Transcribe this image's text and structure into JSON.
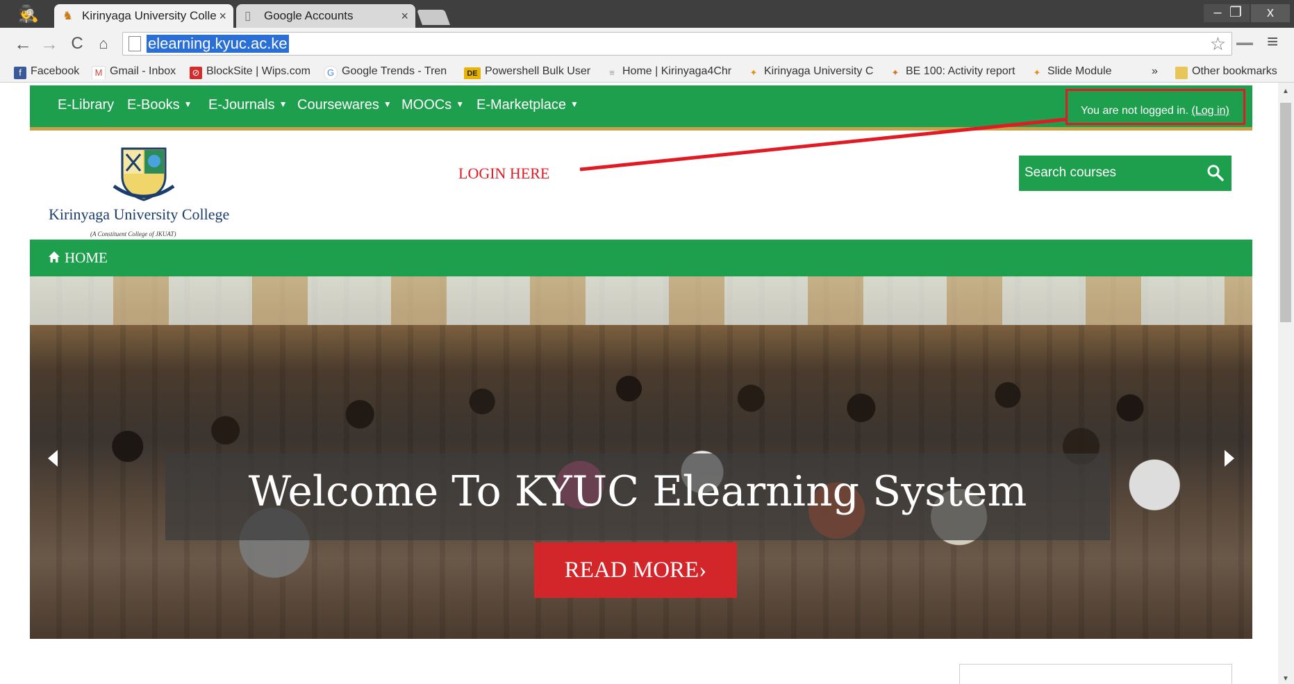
{
  "browser": {
    "tabs": [
      {
        "title": "Kirinyaga University Colle",
        "close": "×"
      },
      {
        "title": "Google Accounts",
        "close": "×"
      }
    ],
    "url": "elearning.kyuc.ac.ke",
    "window_buttons": {
      "minimize": "–",
      "restore": "❐",
      "close": "x"
    },
    "bookmarks": [
      {
        "label": "Facebook",
        "icon": "f"
      },
      {
        "label": "Gmail - Inbox",
        "icon": "M"
      },
      {
        "label": "BlockSite | Wips.com",
        "icon": "⊘"
      },
      {
        "label": "Google Trends - Tren",
        "icon": "G"
      },
      {
        "label": "Powershell Bulk User",
        "icon": "DE"
      },
      {
        "label": "Home | Kirinyaga4Chr",
        "icon": "≡"
      },
      {
        "label": "Kirinyaga University C",
        "icon": "✦"
      },
      {
        "label": "BE 100: Activity report",
        "icon": "✦"
      },
      {
        "label": "Slide Module",
        "icon": "✦"
      }
    ],
    "bookmarks_more": "»",
    "other_bookmarks": "Other bookmarks"
  },
  "site": {
    "nav": [
      {
        "label": "E-Library",
        "dropdown": false
      },
      {
        "label": "E-Books",
        "dropdown": true
      },
      {
        "label": "E-Journals",
        "dropdown": true
      },
      {
        "label": "Coursewares",
        "dropdown": true
      },
      {
        "label": "MOOCs",
        "dropdown": true
      },
      {
        "label": "E-Marketplace",
        "dropdown": true
      }
    ],
    "login_status": "You are not logged in.",
    "login_link": "(Log in)",
    "college_name": "Kirinyaga University College",
    "college_subtitle": "(A Constituent College of JKUAT)",
    "annotation": "LOGIN HERE",
    "search_placeholder": "Search courses",
    "breadcrumb_home": "HOME",
    "hero": {
      "caption": "Welcome To KYUC Elearning System",
      "button": "READ MORE›"
    }
  },
  "colors": {
    "brand_green": "#1e9f4e",
    "accent_red": "#d3262b",
    "annotation_red": "#e01b24",
    "stripe_gold": "#c8a24a"
  }
}
